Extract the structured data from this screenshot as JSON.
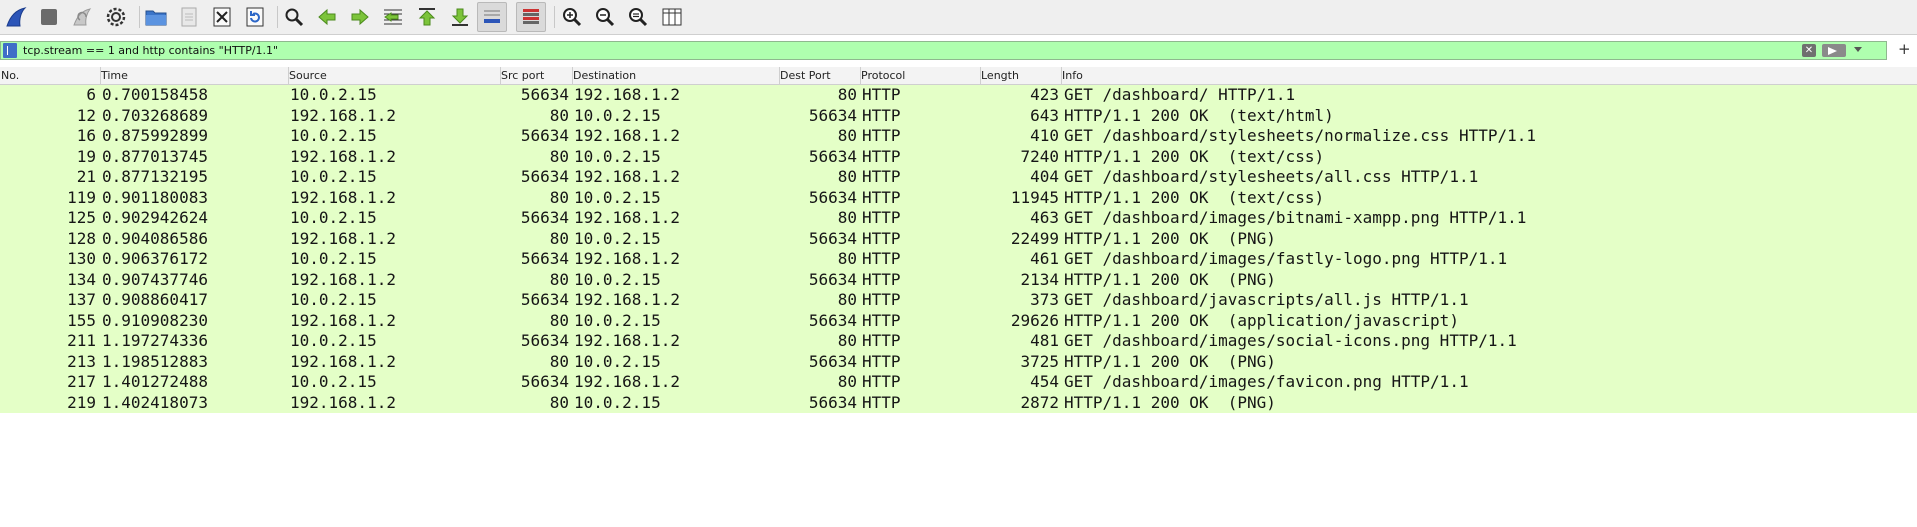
{
  "toolbar": {
    "buttons": [
      {
        "icon": "shark-fin-start-icon"
      },
      {
        "icon": "stop-capture-icon"
      },
      {
        "icon": "restart-capture-icon"
      },
      {
        "icon": "capture-options-icon"
      },
      {
        "icon": "open-file-icon"
      },
      {
        "icon": "save-file-icon"
      },
      {
        "icon": "close-file-icon"
      },
      {
        "icon": "reload-file-icon"
      },
      {
        "icon": "find-packet-icon"
      },
      {
        "icon": "go-back-icon"
      },
      {
        "icon": "go-forward-icon"
      },
      {
        "icon": "go-to-packet-icon"
      },
      {
        "icon": "first-packet-icon"
      },
      {
        "icon": "last-packet-icon"
      },
      {
        "icon": "autoscroll-icon"
      },
      {
        "icon": "colorize-icon"
      },
      {
        "icon": "zoom-in-icon"
      },
      {
        "icon": "zoom-out-icon"
      },
      {
        "icon": "normal-size-icon"
      },
      {
        "icon": "resize-columns-icon"
      }
    ]
  },
  "filter": {
    "value": "tcp.stream == 1 and http contains \"HTTP/1.1\"",
    "bg_color": "#afffaf",
    "add_button": "+"
  },
  "columns": [
    "No.",
    "Time",
    "Source",
    "Src port",
    "Destination",
    "Dest Port",
    "Protocol",
    "Length",
    "Info"
  ],
  "row_color": "#e4ffc7",
  "packets": [
    {
      "no": "6",
      "time": "0.700158458",
      "src": "10.0.2.15",
      "sport": "56634",
      "dst": "192.168.1.2",
      "dport": "80",
      "proto": "HTTP",
      "len": "423",
      "info": "GET /dashboard/ HTTP/1.1"
    },
    {
      "no": "12",
      "time": "0.703268689",
      "src": "192.168.1.2",
      "sport": "80",
      "dst": "10.0.2.15",
      "dport": "56634",
      "proto": "HTTP",
      "len": "643",
      "info": "HTTP/1.1 200 OK  (text/html)"
    },
    {
      "no": "16",
      "time": "0.875992899",
      "src": "10.0.2.15",
      "sport": "56634",
      "dst": "192.168.1.2",
      "dport": "80",
      "proto": "HTTP",
      "len": "410",
      "info": "GET /dashboard/stylesheets/normalize.css HTTP/1.1"
    },
    {
      "no": "19",
      "time": "0.877013745",
      "src": "192.168.1.2",
      "sport": "80",
      "dst": "10.0.2.15",
      "dport": "56634",
      "proto": "HTTP",
      "len": "7240",
      "info": "HTTP/1.1 200 OK  (text/css)"
    },
    {
      "no": "21",
      "time": "0.877132195",
      "src": "10.0.2.15",
      "sport": "56634",
      "dst": "192.168.1.2",
      "dport": "80",
      "proto": "HTTP",
      "len": "404",
      "info": "GET /dashboard/stylesheets/all.css HTTP/1.1"
    },
    {
      "no": "119",
      "time": "0.901180083",
      "src": "192.168.1.2",
      "sport": "80",
      "dst": "10.0.2.15",
      "dport": "56634",
      "proto": "HTTP",
      "len": "11945",
      "info": "HTTP/1.1 200 OK  (text/css)"
    },
    {
      "no": "125",
      "time": "0.902942624",
      "src": "10.0.2.15",
      "sport": "56634",
      "dst": "192.168.1.2",
      "dport": "80",
      "proto": "HTTP",
      "len": "463",
      "info": "GET /dashboard/images/bitnami-xampp.png HTTP/1.1"
    },
    {
      "no": "128",
      "time": "0.904086586",
      "src": "192.168.1.2",
      "sport": "80",
      "dst": "10.0.2.15",
      "dport": "56634",
      "proto": "HTTP",
      "len": "22499",
      "info": "HTTP/1.1 200 OK  (PNG)"
    },
    {
      "no": "130",
      "time": "0.906376172",
      "src": "10.0.2.15",
      "sport": "56634",
      "dst": "192.168.1.2",
      "dport": "80",
      "proto": "HTTP",
      "len": "461",
      "info": "GET /dashboard/images/fastly-logo.png HTTP/1.1"
    },
    {
      "no": "134",
      "time": "0.907437746",
      "src": "192.168.1.2",
      "sport": "80",
      "dst": "10.0.2.15",
      "dport": "56634",
      "proto": "HTTP",
      "len": "2134",
      "info": "HTTP/1.1 200 OK  (PNG)"
    },
    {
      "no": "137",
      "time": "0.908860417",
      "src": "10.0.2.15",
      "sport": "56634",
      "dst": "192.168.1.2",
      "dport": "80",
      "proto": "HTTP",
      "len": "373",
      "info": "GET /dashboard/javascripts/all.js HTTP/1.1"
    },
    {
      "no": "155",
      "time": "0.910908230",
      "src": "192.168.1.2",
      "sport": "80",
      "dst": "10.0.2.15",
      "dport": "56634",
      "proto": "HTTP",
      "len": "29626",
      "info": "HTTP/1.1 200 OK  (application/javascript)"
    },
    {
      "no": "211",
      "time": "1.197274336",
      "src": "10.0.2.15",
      "sport": "56634",
      "dst": "192.168.1.2",
      "dport": "80",
      "proto": "HTTP",
      "len": "481",
      "info": "GET /dashboard/images/social-icons.png HTTP/1.1"
    },
    {
      "no": "213",
      "time": "1.198512883",
      "src": "192.168.1.2",
      "sport": "80",
      "dst": "10.0.2.15",
      "dport": "56634",
      "proto": "HTTP",
      "len": "3725",
      "info": "HTTP/1.1 200 OK  (PNG)"
    },
    {
      "no": "217",
      "time": "1.401272488",
      "src": "10.0.2.15",
      "sport": "56634",
      "dst": "192.168.1.2",
      "dport": "80",
      "proto": "HTTP",
      "len": "454",
      "info": "GET /dashboard/images/favicon.png HTTP/1.1"
    },
    {
      "no": "219",
      "time": "1.402418073",
      "src": "192.168.1.2",
      "sport": "80",
      "dst": "10.0.2.15",
      "dport": "56634",
      "proto": "HTTP",
      "len": "2872",
      "info": "HTTP/1.1 200 OK  (PNG)"
    }
  ]
}
